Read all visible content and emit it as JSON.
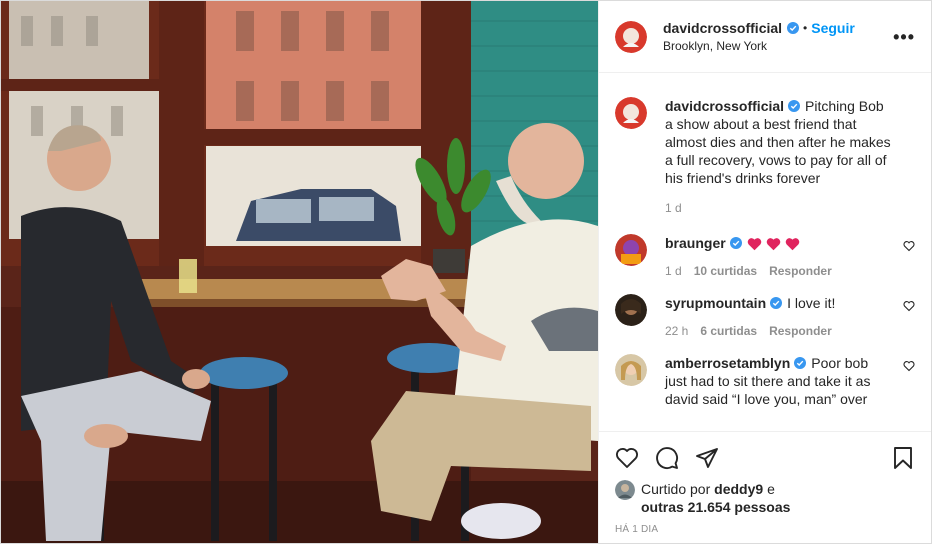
{
  "post": {
    "author": "davidcrossofficial",
    "follow_label": "Seguir",
    "separator": "•",
    "location": "Brooklyn, New York",
    "more_label": "•••"
  },
  "caption": {
    "username": "davidcrossofficial",
    "text": "Pitching Bob a show about a best friend that almost dies and then after he makes a full recovery, vows to pay for all of his friend's drinks forever",
    "age": "1 d"
  },
  "comments": [
    {
      "username": "braunger",
      "text": "",
      "emoji_hearts": 3,
      "age": "1 d",
      "likes": "10 curtidas",
      "reply": "Responder"
    },
    {
      "username": "syrupmountain",
      "text": "I love it!",
      "age": "22 h",
      "likes": "6 curtidas",
      "reply": "Responder"
    },
    {
      "username": "amberrosetamblyn",
      "text": "Poor bob just had to sit there and take it as david said “I love you, man” over",
      "age": "",
      "likes": "",
      "reply": ""
    }
  ],
  "likes": {
    "prefix": "Curtido por",
    "user": "deddy9",
    "joiner": "e",
    "others": "outras 21.654 pessoas"
  },
  "timestamp": "HÁ 1 DIA",
  "colors": {
    "link": "#0095f6",
    "muted": "#8e8e8e",
    "verified": "#3897f0"
  }
}
